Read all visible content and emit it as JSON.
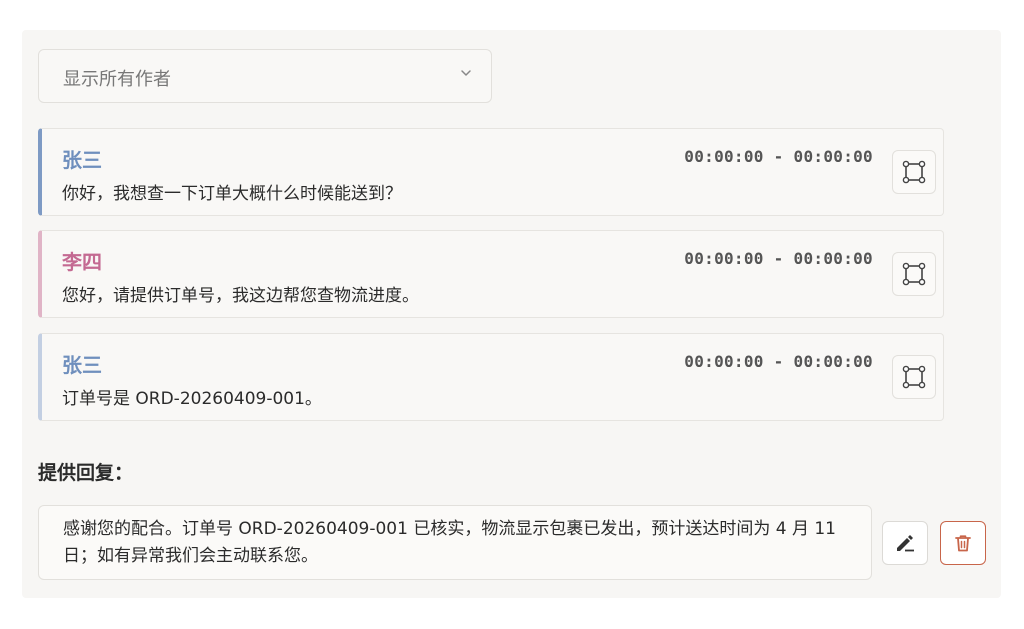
{
  "filter": {
    "author_select_label": "显示所有作者"
  },
  "messages": [
    {
      "speaker": "张三",
      "time_range": "00:00:00 - 00:00:00",
      "text": "你好，我想查一下订单大概什么时候能送到？",
      "speaker_color": "#6f8fbd",
      "accent_color": "#7e9ac4"
    },
    {
      "speaker": "李四",
      "time_range": "00:00:00 - 00:00:00",
      "text": "您好，请提供订单号，我这边帮您查物流进度。",
      "speaker_color": "#c46a92",
      "accent_color": "#e0b4c6"
    },
    {
      "speaker": "张三",
      "time_range": "00:00:00 - 00:00:00",
      "text": "订单号是 ORD-20260409-001。",
      "speaker_color": "#6f8fbd",
      "accent_color": "#c3cfe2"
    }
  ],
  "reply": {
    "label": "提供回复：",
    "text": "感谢您的配合。订单号 ORD-20260409-001 已核实，物流显示包裹已发出，预计送达时间为 4 月 11 日；如有异常我们会主动联系您。"
  },
  "icons": {
    "chevron": "chevron-down-icon",
    "select_region": "bounding-box-icon",
    "edit": "pen-icon",
    "delete": "trash-icon"
  },
  "colors": {
    "delete_accent": "#c8654a"
  }
}
